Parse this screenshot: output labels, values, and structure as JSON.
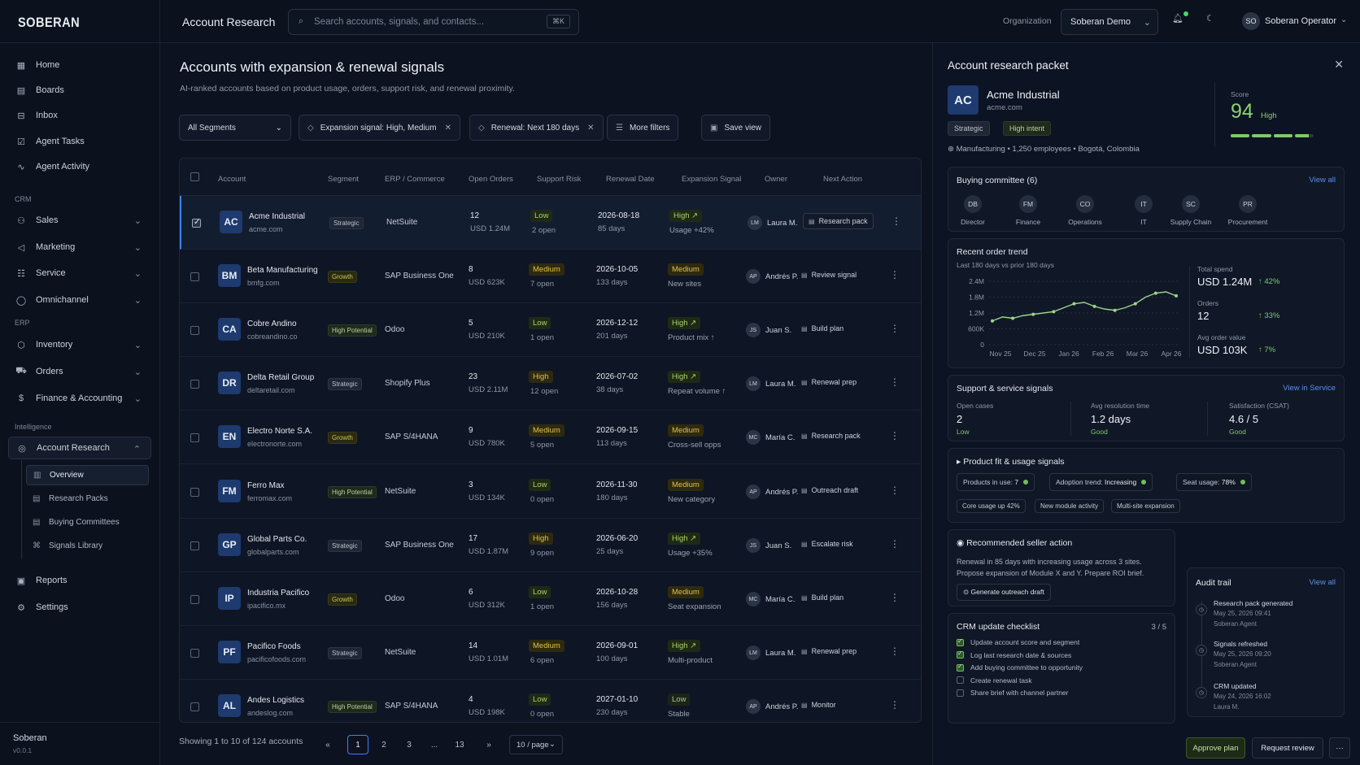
{
  "brand": "SOBERAN",
  "nav": {
    "home": "Home",
    "boards": "Boards",
    "inbox": "Inbox",
    "agent_tasks": "Agent Tasks",
    "agent_activity": "Agent Activity",
    "crm": "CRM",
    "sales": "Sales",
    "marketing": "Marketing",
    "service": "Service",
    "omnichannel": "Omnichannel",
    "erp": "ERP",
    "inventory": "Inventory",
    "orders": "Orders",
    "finance": "Finance & Accounting",
    "intelligence": "Intelligence",
    "account_research": "Account Research",
    "overview": "Overview",
    "research_packs": "Research Packs",
    "buying_committees": "Buying Committees",
    "signals_library": "Signals Library",
    "reports": "Reports",
    "settings": "Settings",
    "org_name": "Soberan",
    "version": "v0.0.1"
  },
  "header": {
    "title": "Account Research",
    "search_placeholder": "Search accounts, signals, and contacts...",
    "kbd": "⌘K",
    "org_label": "Organization",
    "org_value": "Soberan Demo",
    "user_initials": "SO",
    "user_name": "Soberan Operator"
  },
  "main": {
    "title": "Accounts with expansion & renewal signals",
    "subtitle": "AI-ranked accounts based on product usage, orders, support risk, and renewal proximity.",
    "filters": {
      "segments": "All Segments",
      "expansion": "Expansion signal: High, Medium",
      "renewal": "Renewal: Next 180 days",
      "more": "More filters",
      "save": "Save view"
    }
  },
  "table": {
    "headers": [
      "Account",
      "Segment",
      "ERP / Commerce",
      "Open Orders",
      "Support Risk",
      "Renewal Date",
      "Expansion Signal",
      "Owner",
      "Next Action"
    ],
    "rows": [
      {
        "ini": "AC",
        "name": "Acme Industrial",
        "domain": "acme.com",
        "segment": "Strategic",
        "erp": "NetSuite",
        "orders": "12",
        "orders_usd": "USD 1.24M",
        "risk": "Low",
        "risk_open": "2 open",
        "date": "2026-08-18",
        "days": "85 days",
        "signal": "High ↗",
        "signal_note": "Usage +42%",
        "owner_ini": "LM",
        "owner": "Laura M.",
        "action": "Research pack"
      },
      {
        "ini": "BM",
        "name": "Beta Manufacturing",
        "domain": "bmfg.com",
        "segment": "Growth",
        "erp": "SAP Business One",
        "orders": "8",
        "orders_usd": "USD 623K",
        "risk": "Medium",
        "risk_open": "7 open",
        "date": "2026-10-05",
        "days": "133 days",
        "signal": "Medium",
        "signal_note": "New sites",
        "owner_ini": "AP",
        "owner": "Andrés P.",
        "action": "Review signal"
      },
      {
        "ini": "CA",
        "name": "Cobre Andino",
        "domain": "cobreandino.co",
        "segment": "High Potential",
        "erp": "Odoo",
        "orders": "5",
        "orders_usd": "USD 210K",
        "risk": "Low",
        "risk_open": "1 open",
        "date": "2026-12-12",
        "days": "201 days",
        "signal": "High ↗",
        "signal_note": "Product mix ↑",
        "owner_ini": "JS",
        "owner": "Juan S.",
        "action": "Build plan"
      },
      {
        "ini": "DR",
        "name": "Delta Retail Group",
        "domain": "deltaretail.com",
        "segment": "Strategic",
        "erp": "Shopify Plus",
        "orders": "23",
        "orders_usd": "USD 2.11M",
        "risk": "High",
        "risk_open": "12 open",
        "date": "2026-07-02",
        "days": "38 days",
        "signal": "High ↗",
        "signal_note": "Repeat volume ↑",
        "owner_ini": "LM",
        "owner": "Laura M.",
        "action": "Renewal prep"
      },
      {
        "ini": "EN",
        "name": "Electro Norte S.A.",
        "domain": "electronorte.com",
        "segment": "Growth",
        "erp": "SAP S/4HANA",
        "orders": "9",
        "orders_usd": "USD 780K",
        "risk": "Medium",
        "risk_open": "5 open",
        "date": "2026-09-15",
        "days": "113 days",
        "signal": "Medium",
        "signal_note": "Cross-sell opps",
        "owner_ini": "MC",
        "owner": "María C.",
        "action": "Research pack"
      },
      {
        "ini": "FM",
        "name": "Ferro Max",
        "domain": "ferromax.com",
        "segment": "High Potential",
        "erp": "NetSuite",
        "orders": "3",
        "orders_usd": "USD 134K",
        "risk": "Low",
        "risk_open": "0 open",
        "date": "2026-11-30",
        "days": "180 days",
        "signal": "Medium",
        "signal_note": "New category",
        "owner_ini": "AP",
        "owner": "Andrés P.",
        "action": "Outreach draft"
      },
      {
        "ini": "GP",
        "name": "Global Parts Co.",
        "domain": "globalparts.com",
        "segment": "Strategic",
        "erp": "SAP Business One",
        "orders": "17",
        "orders_usd": "USD 1.87M",
        "risk": "High",
        "risk_open": "9 open",
        "date": "2026-06-20",
        "days": "25 days",
        "signal": "High ↗",
        "signal_note": "Usage +35%",
        "owner_ini": "JS",
        "owner": "Juan S.",
        "action": "Escalate risk"
      },
      {
        "ini": "IP",
        "name": "Industria Pacifico",
        "domain": "ipacifico.mx",
        "segment": "Growth",
        "erp": "Odoo",
        "orders": "6",
        "orders_usd": "USD 312K",
        "risk": "Low",
        "risk_open": "1 open",
        "date": "2026-10-28",
        "days": "156 days",
        "signal": "Medium",
        "signal_note": "Seat expansion",
        "owner_ini": "MC",
        "owner": "María C.",
        "action": "Build plan"
      },
      {
        "ini": "PF",
        "name": "Pacifico Foods",
        "domain": "pacificofoods.com",
        "segment": "Strategic",
        "erp": "NetSuite",
        "orders": "14",
        "orders_usd": "USD 1.01M",
        "risk": "Medium",
        "risk_open": "6 open",
        "date": "2026-09-01",
        "days": "100 days",
        "signal": "High ↗",
        "signal_note": "Multi-product",
        "owner_ini": "LM",
        "owner": "Laura M.",
        "action": "Renewal prep"
      },
      {
        "ini": "AL",
        "name": "Andes Logistics",
        "domain": "andeslog.com",
        "segment": "High Potential",
        "erp": "SAP S/4HANA",
        "orders": "4",
        "orders_usd": "USD 198K",
        "risk": "Low",
        "risk_open": "0 open",
        "date": "2027-01-10",
        "days": "230 days",
        "signal": "Low",
        "signal_note": "Stable",
        "owner_ini": "AP",
        "owner": "Andrés P.",
        "action": "Monitor"
      }
    ],
    "footer": "Showing 1 to 10 of 124 accounts",
    "pages": [
      "1",
      "2",
      "3",
      "...",
      "13"
    ],
    "per_page": "10 / page"
  },
  "panel": {
    "title": "Account research packet",
    "ini": "AC",
    "name": "Acme Industrial",
    "domain": "acme.com",
    "tag1": "Strategic",
    "tag2": "High intent",
    "meta": "Manufacturing  •  1,250 employees  •  Bogotá, Colombia",
    "score_label": "Score",
    "score": "94",
    "score_level": "High",
    "score_fraction": 0.94,
    "committee": {
      "title": "Buying committee (6)",
      "view_all": "View all",
      "members": [
        {
          "ini": "DB",
          "role": "Director"
        },
        {
          "ini": "FM",
          "role": "Finance"
        },
        {
          "ini": "CO",
          "role": "Operations"
        },
        {
          "ini": "IT",
          "role": "IT"
        },
        {
          "ini": "SC",
          "role": "Supply Chain"
        },
        {
          "ini": "PR",
          "role": "Procurement"
        }
      ]
    },
    "trend": {
      "title": "Recent order trend",
      "subtitle": "Last 180 days vs prior 180 days",
      "total_label": "Total spend",
      "total": "USD 1.24M",
      "total_delta": "↑ 42%",
      "orders_label": "Orders",
      "orders": "12",
      "orders_delta": "↑ 33%",
      "aov_label": "Avg order value",
      "aov": "USD 103K",
      "aov_delta": "↑ 7%"
    },
    "support": {
      "title": "Support & service signals",
      "link": "View in Service",
      "c1_label": "Open cases",
      "c1": "2",
      "c1_s": "Low",
      "c2_label": "Avg resolution time",
      "c2": "1.2 days",
      "c2_s": "Good",
      "c3_label": "Satisfaction (CSAT)",
      "c3": "4.6 / 5",
      "c3_s": "Good"
    },
    "fit": {
      "title": "Product fit & usage signals",
      "products_label": "Products in use:",
      "products": "7",
      "adoption_label": "Adoption trend:",
      "adoption": "Increasing",
      "seat_label": "Seat usage:",
      "seat": "78%",
      "tag1": "Core usage up 42%",
      "tag2": "New module activity",
      "tag3": "Multi-site expansion"
    },
    "rec": {
      "title": "Recommended seller action",
      "text1": "Renewal in 85 days with increasing usage across 3 sites.",
      "text2": "Propose expansion of Module X and Y. Prepare ROI brief.",
      "btn": "Generate outreach draft"
    },
    "checklist": {
      "title": "CRM update checklist",
      "count": "3 / 5",
      "items": [
        {
          "t": "Update account score and segment",
          "done": true
        },
        {
          "t": "Log last research date & sources",
          "done": true
        },
        {
          "t": "Add buying committee to opportunity",
          "done": true
        },
        {
          "t": "Create renewal task",
          "done": false
        },
        {
          "t": "Share brief with channel partner",
          "done": false
        }
      ]
    },
    "audit": {
      "title": "Audit trail",
      "view_all": "View all",
      "items": [
        {
          "t": "Research pack generated",
          "d": "May 25, 2026 09:41",
          "by": "Soberan Agent"
        },
        {
          "t": "Signals refreshed",
          "d": "May 25, 2026 09:20",
          "by": "Soberan Agent"
        },
        {
          "t": "CRM updated",
          "d": "May 24, 2026 16:02",
          "by": "Laura M."
        }
      ]
    },
    "approve": "Approve plan",
    "review": "Request review",
    "more": "···"
  },
  "chart_data": {
    "type": "line",
    "title": "Recent order trend",
    "x_ticks": [
      "Nov 25",
      "Dec 25",
      "Jan 26",
      "Feb 26",
      "Mar 26",
      "Apr 26"
    ],
    "y_ticks": [
      "2.4M",
      "1.8M",
      "1.2M",
      "600K",
      "0"
    ],
    "ylim": [
      0,
      2400000
    ],
    "series": [
      {
        "values": [
          900000,
          1050000,
          1000000,
          1100000,
          1150000,
          1200000,
          1250000,
          1400000,
          1550000,
          1600000,
          1450000,
          1350000,
          1300000,
          1400000,
          1550000,
          1800000,
          1950000,
          2000000,
          1850000
        ]
      }
    ]
  }
}
